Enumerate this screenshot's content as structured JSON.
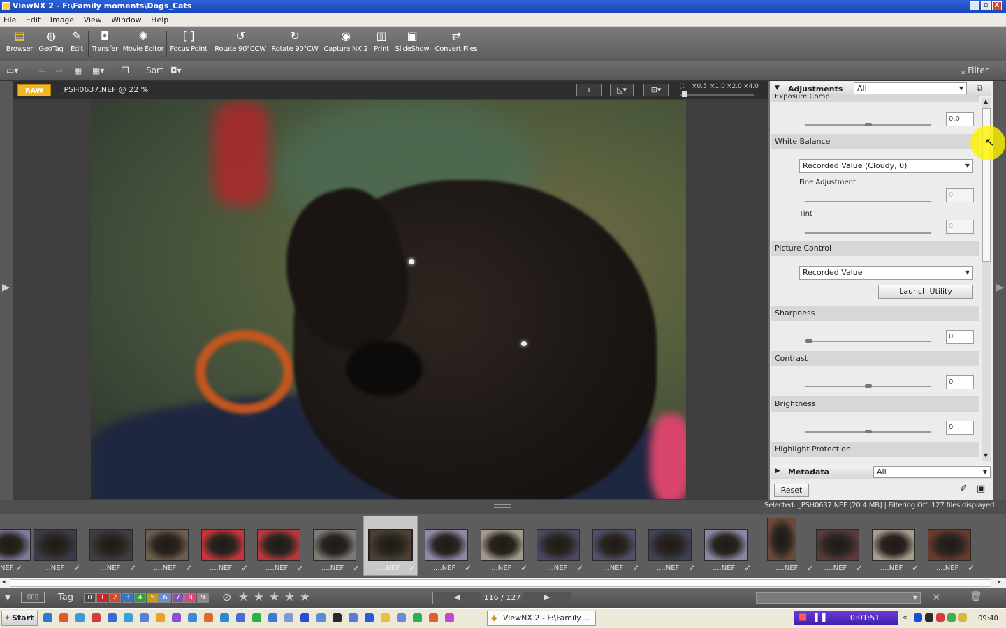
{
  "window": {
    "title": "ViewNX 2 - F:\\Family moments\\Dogs_Cats",
    "controls": {
      "minimize": "_",
      "maximize": "▫",
      "close": "X"
    }
  },
  "menu": [
    "File",
    "Edit",
    "Image",
    "View",
    "Window",
    "Help"
  ],
  "toolbar": [
    {
      "label": "Browser",
      "icon": "browser-icon"
    },
    {
      "label": "GeoTag",
      "icon": "globe-icon"
    },
    {
      "label": "Edit",
      "icon": "pencil-icon"
    },
    {
      "label": "Transfer",
      "icon": "camera-icon"
    },
    {
      "label": "Movie Editor",
      "icon": "film-icon"
    },
    {
      "label": "Focus Point",
      "icon": "focus-icon"
    },
    {
      "label": "Rotate 90°CCW",
      "icon": "rotate-ccw-icon"
    },
    {
      "label": "Rotate 90°CW",
      "icon": "rotate-cw-icon"
    },
    {
      "label": "Capture NX 2",
      "icon": "capture-icon"
    },
    {
      "label": "Print",
      "icon": "printer-icon"
    },
    {
      "label": "SlideShow",
      "icon": "slideshow-icon"
    },
    {
      "label": "Convert Files",
      "icon": "convert-icon"
    }
  ],
  "toolbar2": {
    "sort_label": "Sort",
    "filter_label": "Filter"
  },
  "viewer": {
    "badge": "RAW",
    "filename": "_PSH0637.NEF @ 22 %",
    "zoom_levels": [
      "×0.5",
      "×1.0",
      "×2.0",
      "×4.0"
    ]
  },
  "adjustments": {
    "header": "Adjustments",
    "scope": "All",
    "exposure": {
      "label": "Exposure Comp.",
      "value": "0.0"
    },
    "white_balance": {
      "label": "White Balance",
      "select": "Recorded Value (Cloudy, 0)",
      "fine_label": "Fine Adjustment",
      "fine_value": "0",
      "tint_label": "Tint",
      "tint_value": "0"
    },
    "picture_control": {
      "label": "Picture Control",
      "select": "Recorded Value",
      "launch": "Launch Utility"
    },
    "sharpness": {
      "label": "Sharpness",
      "value": "0"
    },
    "contrast": {
      "label": "Contrast",
      "value": "0"
    },
    "brightness": {
      "label": "Brightness",
      "value": "0"
    },
    "highlight": {
      "label": "Highlight Protection"
    }
  },
  "metadata": {
    "header": "Metadata",
    "scope": "All"
  },
  "reset_label": "Reset",
  "status": "Selected: _PSH0637.NEF [20.4 MB] | Filtering Off: 127 files displayed",
  "filmstrip": {
    "labels": [
      "NEF",
      "....NEF",
      "....NEF",
      "....NEF",
      "....NEF",
      "....NEF",
      "....NEF",
      "....NEF",
      "....NEF",
      "....NEF",
      "....NEF",
      "....NEF",
      "....NEF",
      "....NEF",
      "....NEF",
      "....NEF",
      "....NEF",
      "....NEF"
    ]
  },
  "bottom": {
    "tag_label": "Tag",
    "labels": [
      "0",
      "1",
      "2",
      "3",
      "4",
      "5",
      "6",
      "7",
      "8",
      "9"
    ],
    "label_colors": [
      "#4a4a4a",
      "#c9262b",
      "#d4472e",
      "#3a74c2",
      "#2f9f3b",
      "#c79a16",
      "#6a8fcf",
      "#8a4fb5",
      "#d6497a",
      "#8a8a8a"
    ],
    "counter": "116 / 127",
    "prev": "◀",
    "next": "▶"
  },
  "taskbar": {
    "start": "Start",
    "task": "ViewNX 2 - F:\\Family ...",
    "rec_time": "0:01:51",
    "clock": "09:40"
  }
}
